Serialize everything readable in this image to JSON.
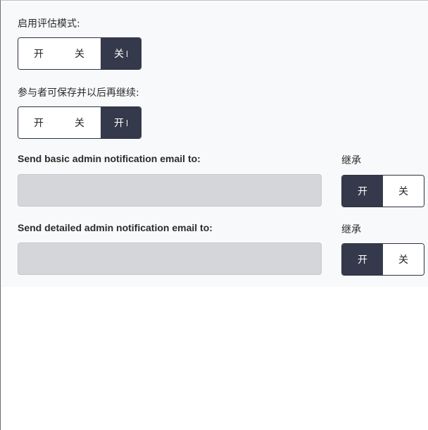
{
  "assessment_mode": {
    "label": "启用评估模式:",
    "options": [
      "开",
      "关",
      "关"
    ],
    "selected_index": 2
  },
  "save_resume": {
    "label": "参与者可保存并以后再继续:",
    "options": [
      "开",
      "关",
      "开"
    ],
    "selected_index": 2
  },
  "basic_email": {
    "label": "Send basic admin notification email to:",
    "value": "",
    "inherit_label": "继承",
    "inherit_options": [
      "开",
      "关"
    ],
    "inherit_selected_index": 0
  },
  "detailed_email": {
    "label": "Send detailed admin notification email to:",
    "value": "",
    "inherit_label": "继承",
    "inherit_options": [
      "开",
      "关"
    ],
    "inherit_selected_index": 0
  },
  "colors": {
    "active_bg": "#343a4b",
    "panel_bg": "#f8f9fa",
    "input_bg": "#d4d6da"
  }
}
